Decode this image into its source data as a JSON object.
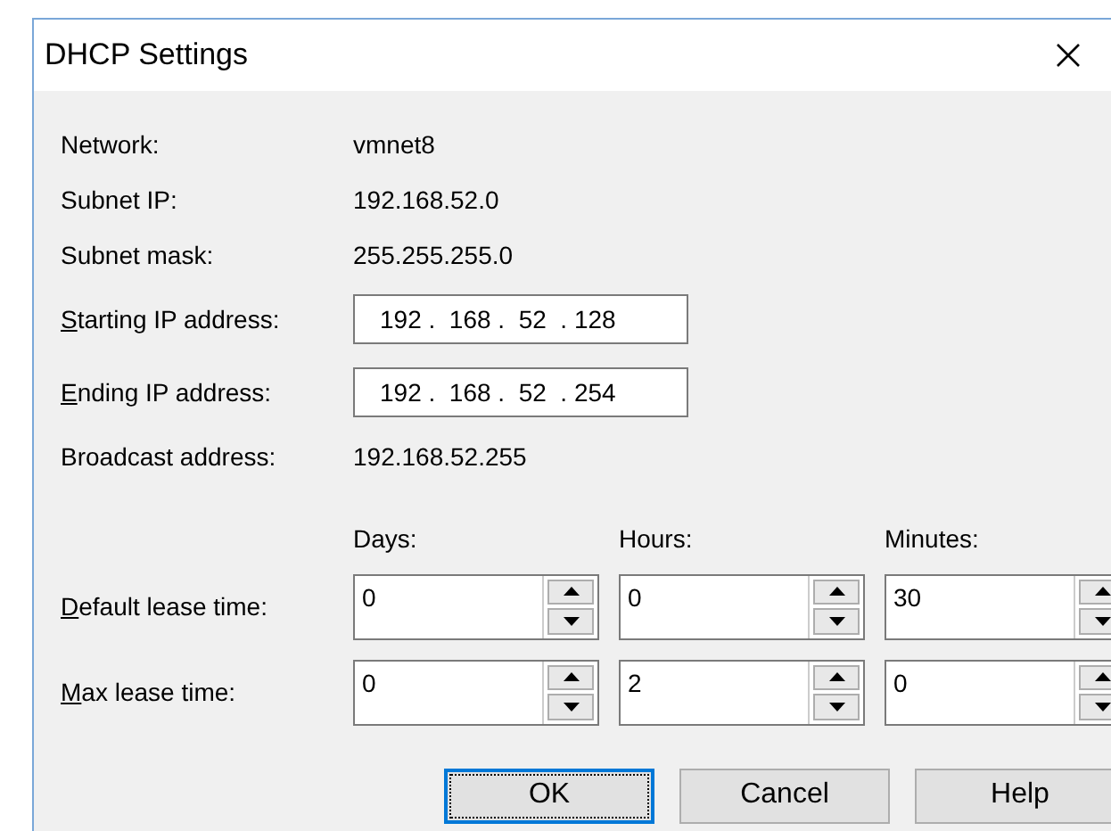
{
  "window": {
    "title": "DHCP Settings"
  },
  "info": [
    {
      "label": "Network:",
      "value": "vmnet8"
    },
    {
      "label": "Subnet IP:",
      "value": "192.168.52.0"
    },
    {
      "label": "Subnet mask:",
      "value": "255.255.255.0"
    }
  ],
  "ip_fields": [
    {
      "label": "Starting IP address:",
      "mnemonic": true,
      "value": "192 .  168 .  52  . 128"
    },
    {
      "label": "Ending IP address:",
      "mnemonic": true,
      "value": "192 .  168 .  52  . 254"
    }
  ],
  "broadcast": {
    "label": "Broadcast address:",
    "value": "192.168.52.255"
  },
  "lease_columns": [
    "Days:",
    "Hours:",
    "Minutes:"
  ],
  "lease_rows": [
    {
      "label": "Default lease time:",
      "mnemonic": true,
      "values": [
        "0",
        "0",
        "30"
      ]
    },
    {
      "label": "Max lease time:",
      "mnemonic": true,
      "values": [
        "0",
        "2",
        "0"
      ]
    }
  ],
  "buttons": [
    {
      "label": "OK",
      "default": true
    },
    {
      "label": "Cancel",
      "default": false
    },
    {
      "label": "Help",
      "default": false
    }
  ]
}
